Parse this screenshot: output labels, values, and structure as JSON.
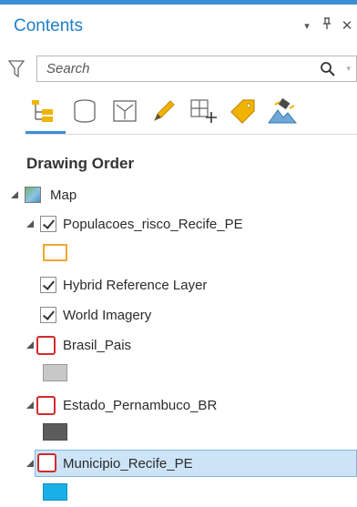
{
  "pane": {
    "title": "Contents",
    "controls": [
      "▾",
      "ꟷ",
      "✕"
    ]
  },
  "search": {
    "placeholder": "Search"
  },
  "toolbar": {
    "tools": [
      "list-by-drawing-order",
      "list-by-source",
      "list-by-selection",
      "list-by-editing",
      "list-by-snapping",
      "list-by-labeling",
      "list-by-perspective-imagery"
    ]
  },
  "section": {
    "title": "Drawing Order"
  },
  "tree": {
    "map": "Map",
    "layer_populacoes": "Populacoes_risco_Recife_PE",
    "layer_hybrid": "Hybrid Reference Layer",
    "layer_world": "World Imagery",
    "layer_brasil": "Brasil_Pais",
    "layer_estado": "Estado_Pernambuco_BR",
    "layer_municipio": "Municipio_Recife_PE"
  },
  "symbols": {
    "populacoes": {
      "fill": "#ffffff",
      "stroke": "#f0a830"
    },
    "brasil": {
      "fill": "#c8c8c8",
      "stroke": "#9a9a9a"
    },
    "estado": {
      "fill": "#5c5c5c",
      "stroke": "#4a4a4a"
    },
    "municipio": {
      "fill": "#19b0e8",
      "stroke": "#1290c4"
    }
  },
  "colors": {
    "accent": "#3a8fd6",
    "highlight": "#d22b2b",
    "selection": "#cde4f7"
  }
}
